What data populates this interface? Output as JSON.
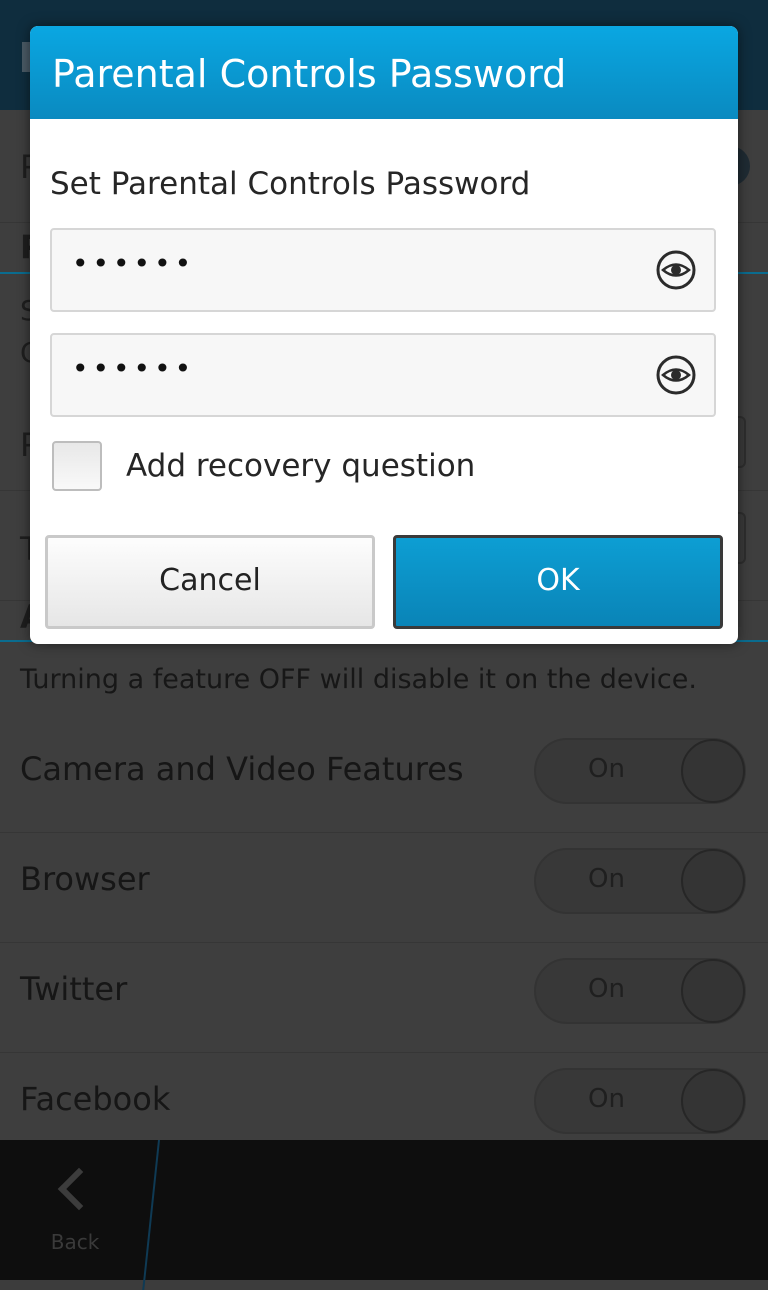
{
  "background": {
    "row_initials": [
      "P",
      "P",
      "S",
      "C",
      "P",
      "T",
      "A"
    ],
    "note": "Turning a feature OFF will disable it on the device.",
    "features": [
      {
        "label": "Camera and Video Features",
        "toggle": "On"
      },
      {
        "label": "Browser",
        "toggle": "On"
      },
      {
        "label": "Twitter",
        "toggle": "On"
      },
      {
        "label": "Facebook",
        "toggle": "On"
      }
    ]
  },
  "dialog": {
    "title": "Parental Controls Password",
    "subtitle": "Set Parental Controls Password",
    "password_masked": "••••••",
    "confirm_masked": "••••••",
    "recovery_label": "Add recovery question",
    "recovery_checked": false,
    "cancel_label": "Cancel",
    "ok_label": "OK"
  },
  "action_bar": {
    "back_label": "Back"
  },
  "colors": {
    "accent": "#0a9fd8",
    "dim_background": "#3e3e3e"
  },
  "icons": [
    "eye-icon",
    "chevron-left-icon"
  ]
}
